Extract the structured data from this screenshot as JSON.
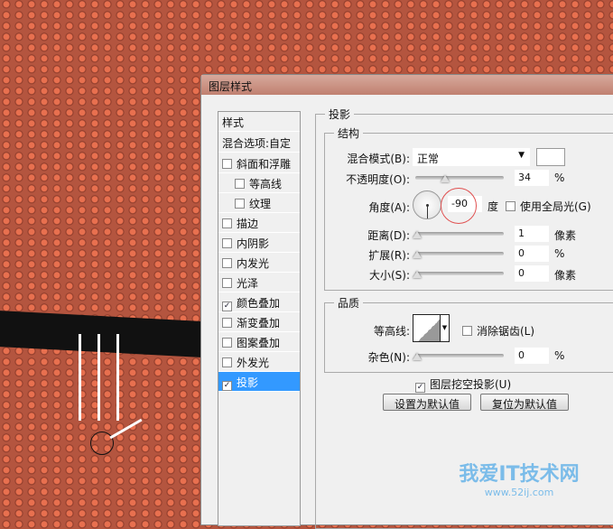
{
  "dialog": {
    "title": "图层样式"
  },
  "styles_list": {
    "header": "样式",
    "blend_options": "混合选项:自定",
    "items": [
      {
        "label": "斜面和浮雕",
        "checked": false,
        "indent": false
      },
      {
        "label": "等高线",
        "checked": false,
        "indent": true
      },
      {
        "label": "纹理",
        "checked": false,
        "indent": true
      },
      {
        "label": "描边",
        "checked": false,
        "indent": false
      },
      {
        "label": "内阴影",
        "checked": false,
        "indent": false
      },
      {
        "label": "内发光",
        "checked": false,
        "indent": false
      },
      {
        "label": "光泽",
        "checked": false,
        "indent": false
      },
      {
        "label": "颜色叠加",
        "checked": true,
        "indent": false
      },
      {
        "label": "渐变叠加",
        "checked": false,
        "indent": false
      },
      {
        "label": "图案叠加",
        "checked": false,
        "indent": false
      },
      {
        "label": "外发光",
        "checked": false,
        "indent": false
      },
      {
        "label": "投影",
        "checked": true,
        "indent": false,
        "selected": true
      }
    ]
  },
  "panel": {
    "title": "投影",
    "structure": {
      "title": "结构",
      "blend_mode_label": "混合模式(B):",
      "blend_mode": "正常",
      "opacity_label": "不透明度(O):",
      "opacity": "34",
      "opacity_unit": "%",
      "angle_label": "角度(A):",
      "angle": "-90",
      "angle_unit": "度",
      "global_light": "使用全局光(G)",
      "distance_label": "距离(D):",
      "distance": "1",
      "distance_unit": "像素",
      "spread_label": "扩展(R):",
      "spread": "0",
      "spread_unit": "%",
      "size_label": "大小(S):",
      "size": "0",
      "size_unit": "像素"
    },
    "quality": {
      "title": "品质",
      "contour_label": "等高线:",
      "antialias": "消除锯齿(L)",
      "noise_label": "杂色(N):",
      "noise": "0",
      "noise_unit": "%"
    },
    "knockout": "图层挖空投影(U)",
    "make_default": "设置为默认值",
    "reset_default": "复位为默认值"
  },
  "watermark": {
    "text": "我爱IT技术网",
    "url": "www.52ij.com"
  },
  "colors": {
    "selected": "#3399ff",
    "highlight_circle": "#e05050"
  }
}
